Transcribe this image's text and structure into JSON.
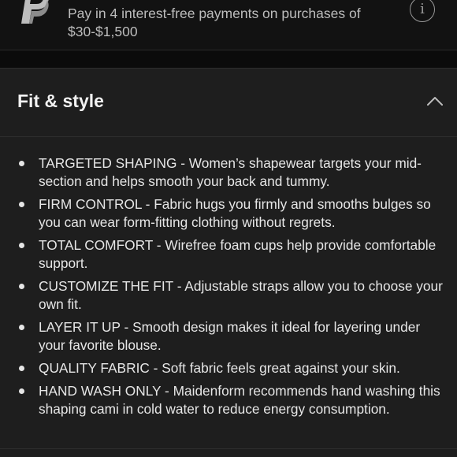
{
  "paypal_banner": {
    "logo": "paypal-logo-icon",
    "text": "Pay in 4 interest-free payments on purchases of $30-$1,500",
    "info_icon": "info-icon",
    "info_glyph": "i"
  },
  "section": {
    "title": "Fit & style",
    "chevron_icon": "chevron-up-icon",
    "expanded": true,
    "bullets": [
      {
        "text": "TARGETED SHAPING - Women’s shapewear targets your mid-section and helps smooth your back and tummy."
      },
      {
        "text": "FIRM CONTROL - Fabric hugs you firmly and smooths bulges so you can wear form-fitting clothing without regrets."
      },
      {
        "text": "TOTAL COMFORT - Wirefree foam cups help provide comfortable support."
      },
      {
        "text": "CUSTOMIZE THE FIT - Adjustable straps allow you to choose your own fit."
      },
      {
        "text": "LAYER IT UP - Smooth design makes it ideal for layering under your favorite blouse."
      },
      {
        "text": "QUALITY FABRIC - Soft fabric feels great against your skin."
      },
      {
        "text": "HAND WASH ONLY - Maidenform recommends hand washing this shaping cami in cold water to reduce energy consumption."
      }
    ]
  },
  "colors": {
    "background": "#121212",
    "section_background": "#1e1e1e",
    "text": "#e6e6e6",
    "muted_text": "#bdbdbd"
  }
}
